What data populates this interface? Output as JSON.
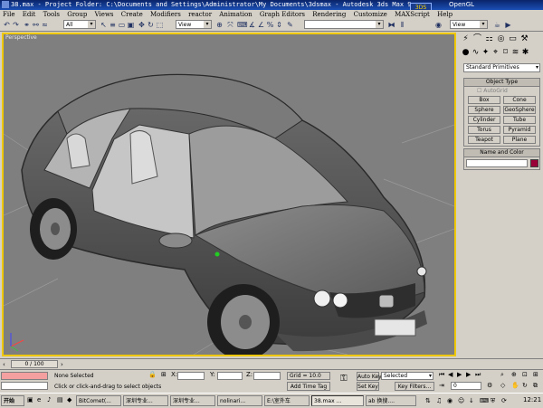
{
  "window": {
    "title": "38.max  - Project Folder: C:\\Documents and Settings\\Administrator\\My Documents\\3dsmax  - Autodesk 3ds Max 9",
    "renderer": "OpenGL",
    "logo_text": "3DS MAX"
  },
  "menu": [
    "File",
    "Edit",
    "Tools",
    "Group",
    "Views",
    "Create",
    "Modifiers",
    "reactor",
    "Animation",
    "Graph Editors",
    "Rendering",
    "Customize",
    "MAXScript",
    "Help"
  ],
  "toolbar": {
    "selection_filter": "All",
    "reference_coord": "View",
    "named_selection": "",
    "view_combo": "View"
  },
  "viewport": {
    "label": "Perspective"
  },
  "command_panel": {
    "category_dropdown": "Standard Primitives",
    "object_type_title": "Object Type",
    "autogrid_label": "AutoGrid",
    "object_buttons": [
      "Box",
      "Cone",
      "Sphere",
      "GeoSphere",
      "Cylinder",
      "Tube",
      "Torus",
      "Pyramid",
      "Teapot",
      "Plane"
    ],
    "name_color_title": "Name and Color",
    "object_name": "",
    "object_color": "#9a0038"
  },
  "timeline": {
    "frame_display": "0 / 100"
  },
  "status": {
    "selection_status": "None Selected",
    "x_label": "X:",
    "y_label": "Y:",
    "z_label": "Z:",
    "grid": "Grid = 10.0",
    "prompt": "Click or click-and-drag to select objects",
    "add_time_tag": "Add Time Tag",
    "auto_key": "Auto Key",
    "set_key": "Set Key",
    "key_mode": "Selected",
    "key_filters": "Key Filters...",
    "frame": "0"
  },
  "taskbar": {
    "start_label": "开始",
    "items": [
      "BitComet(...",
      "深圳专业...",
      "深圳专业...",
      "nolinari...",
      "E:\\室外车",
      "38.max ...",
      "ab 换搜...."
    ],
    "active_index": 5,
    "clock": "12:21"
  }
}
